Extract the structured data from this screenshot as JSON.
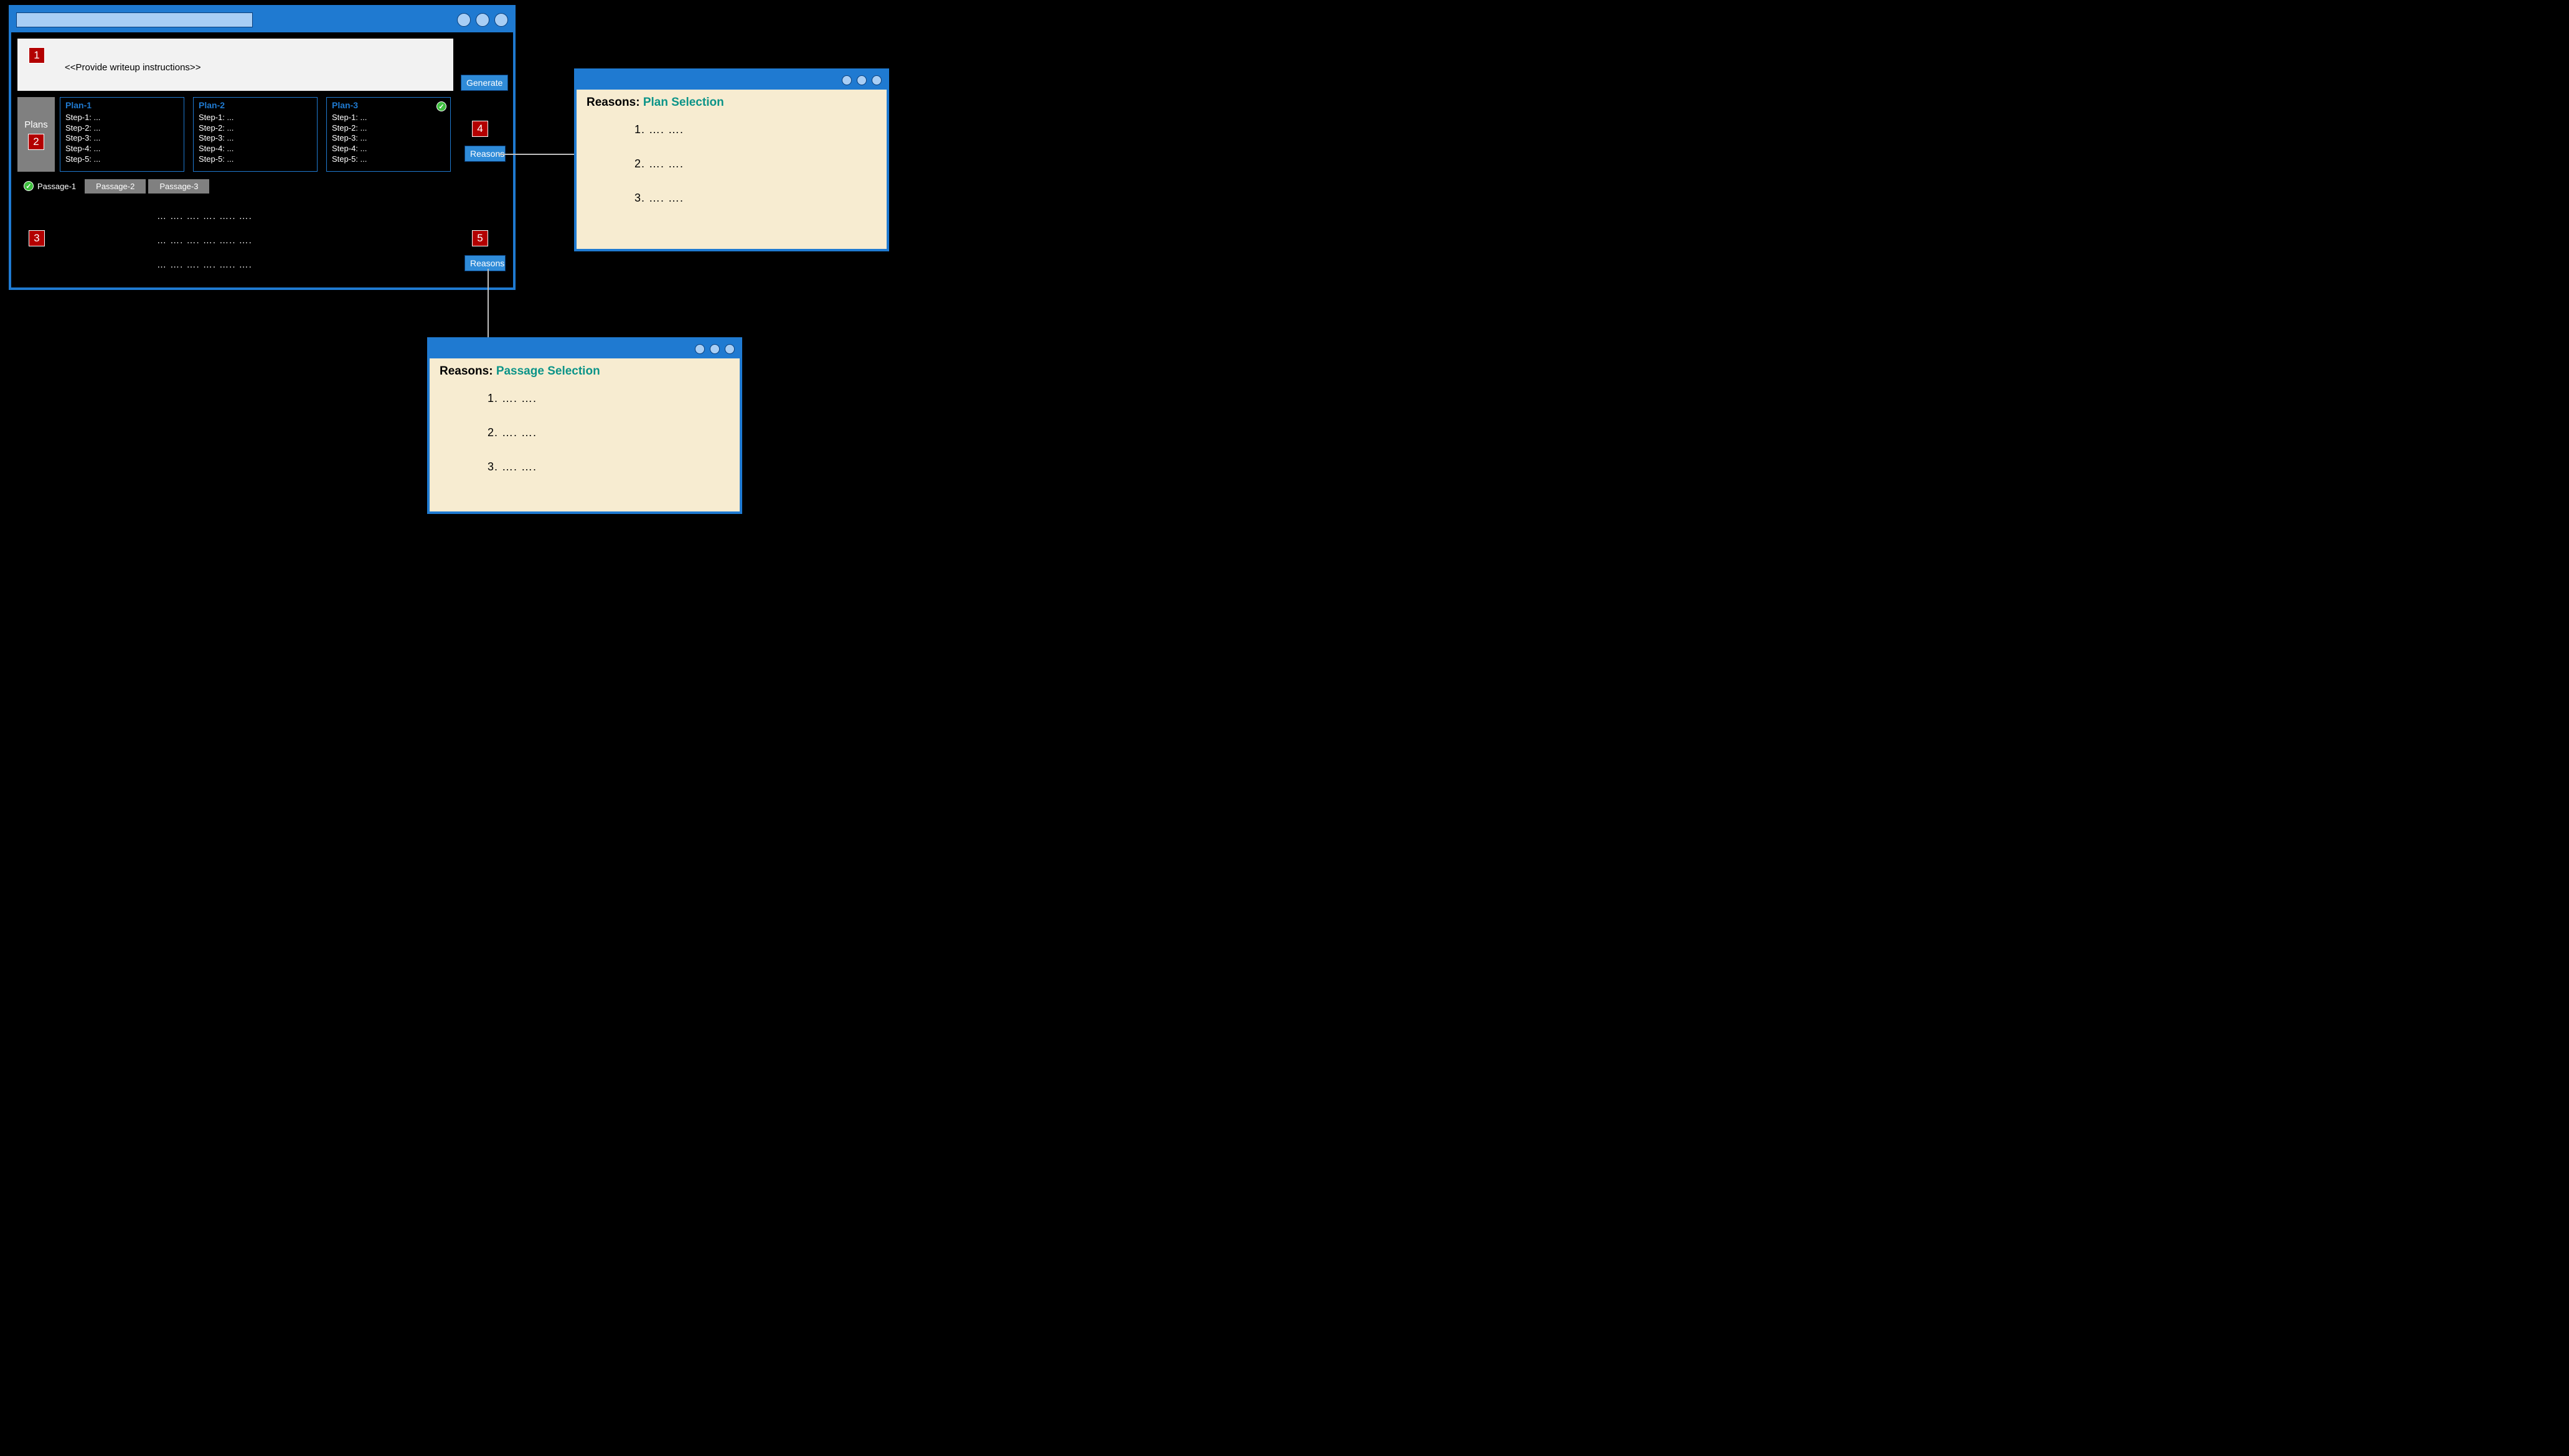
{
  "main": {
    "instruction_placeholder": "<<Provide writeup instructions>>",
    "generate_label": "Generate",
    "plans_label": "Plans",
    "reasons_label_plans": "Reasons",
    "reasons_label_passage": "Reasons",
    "plans": [
      {
        "title": "Plan-1",
        "steps": [
          "Step-1: ...",
          "Step-2: ...",
          "Step-3: ...",
          "Step-4: ...",
          "Step-5: ..."
        ],
        "selected": false
      },
      {
        "title": "Plan-2",
        "steps": [
          "Step-1: ...",
          "Step-2: ...",
          "Step-3: ...",
          "Step-4: ...",
          "Step-5: ..."
        ],
        "selected": false
      },
      {
        "title": "Plan-3",
        "steps": [
          "Step-1: ...",
          "Step-2: ...",
          "Step-3: ...",
          "Step-4: ...",
          "Step-5: ..."
        ],
        "selected": true
      }
    ],
    "passage_tabs": [
      {
        "label": "Passage-1",
        "selected": true
      },
      {
        "label": "Passage-2",
        "selected": false
      },
      {
        "label": "Passage-3",
        "selected": false
      }
    ],
    "passage_lines": [
      "…   ….   ….   ….   …..  ….",
      "…   ….   ….   ….   …..  ….",
      "…   ….   ….   ….   …..  ….  "
    ],
    "markers": {
      "1": "1",
      "2": "2",
      "3": "3",
      "4": "4",
      "5": "5"
    }
  },
  "popup_plan": {
    "prefix": "Reasons: ",
    "title": "Plan Selection",
    "items": [
      "….    ….",
      "….    ….",
      "….    …."
    ]
  },
  "popup_passage": {
    "prefix": "Reasons: ",
    "title": "Passage Selection",
    "items": [
      "….    ….",
      "….    ….",
      "….    …."
    ]
  }
}
